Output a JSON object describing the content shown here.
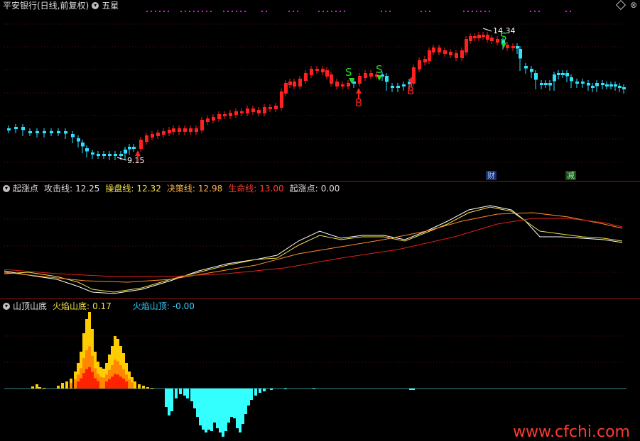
{
  "header": {
    "stock_title": "平安银行(日线,前复权)",
    "indicator_name": "五星"
  },
  "panel1": {
    "high_label": "14.34",
    "low_label": "9.15",
    "signals": [
      {
        "type": "S",
        "label": "S"
      },
      {
        "type": "S",
        "label": "S"
      },
      {
        "type": "S",
        "label": "S"
      },
      {
        "type": "B",
        "label": "B"
      },
      {
        "type": "B",
        "label": "B"
      }
    ],
    "badges": {
      "cai": "财",
      "jian": "减"
    }
  },
  "panel2": {
    "name": "起涨点",
    "attack_label": "攻击线:",
    "attack_value": "12.25",
    "trade_label": "操盘线:",
    "trade_value": "12.32",
    "decision_label": "决策线:",
    "decision_value": "12.98",
    "life_label": "生命线:",
    "life_value": "13.00",
    "rise_label": "起涨点:",
    "rise_value": "0.00"
  },
  "panel3": {
    "name": "山顶山底",
    "bottom_label": "火焰山底:",
    "bottom_value": "0.17",
    "top_label": "火焰山顶:",
    "top_value": "-0.00"
  },
  "watermark": "www.cfchi.com",
  "colors": {
    "up": "#ff2020",
    "down": "#30e0ff",
    "border": "#8b1a1a",
    "grid": "#5a1010",
    "yellow": "#f3e04a",
    "orange": "#ff8c2a",
    "red": "#e02020",
    "white": "#ffffff",
    "cyan": "#33ffff",
    "magenta": "#ff00ff"
  }
}
